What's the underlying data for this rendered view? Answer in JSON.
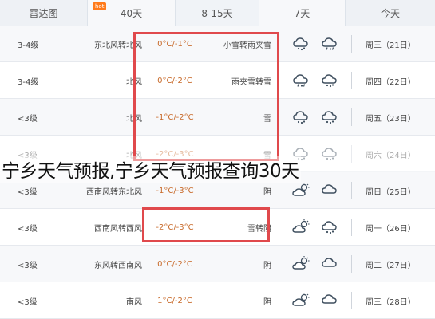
{
  "tabs": [
    {
      "label": "雷达图"
    },
    {
      "label": "40天",
      "badge": "hot"
    },
    {
      "label": "8-15天"
    },
    {
      "label": "7天"
    },
    {
      "label": "今天"
    }
  ],
  "rows": [
    {
      "level": "3-4级",
      "wind": "东北风转北风",
      "temp": "0°C/-1°C",
      "cond": "小雪转雨夹雪",
      "icons": [
        "snow-cloud-icon",
        "sleet-cloud-icon"
      ],
      "date": "周三（21日）"
    },
    {
      "level": "3-4级",
      "wind": "北风",
      "temp": "0°C/-2°C",
      "cond": "雨夹雪转雪",
      "icons": [
        "sleet-cloud-icon",
        "snow-cloud-icon"
      ],
      "date": "周四（22日）"
    },
    {
      "level": "<3级",
      "wind": "北风",
      "temp": "-1°C/-2°C",
      "cond": "雪",
      "icons": [
        "snow-cloud-icon",
        "snow-cloud-icon"
      ],
      "date": "周五（23日）"
    },
    {
      "level": "<3级",
      "wind": "北风",
      "temp": "-2°C/-3°C",
      "cond": "雪",
      "icons": [
        "snow-cloud-icon",
        "snow-cloud-icon"
      ],
      "date": "周六（24日）"
    },
    {
      "level": "<3级",
      "wind": "西南风转东北风",
      "temp": "-1°C/-3°C",
      "cond": "阴",
      "icons": [
        "partly-cloudy-icon",
        "cloud-icon"
      ],
      "date": "周日（25日）"
    },
    {
      "level": "<3级",
      "wind": "西南风转西风",
      "temp": "-2°C/-3°C",
      "cond": "雪转阴",
      "icons": [
        "partly-cloudy-icon",
        "snow-cloud-icon"
      ],
      "date": "周一（26日）"
    },
    {
      "level": "<3级",
      "wind": "东风转西南风",
      "temp": "0°C/-2°C",
      "cond": "阴",
      "icons": [
        "partly-cloudy-icon",
        "cloud-icon"
      ],
      "date": "周二（27日）"
    },
    {
      "level": "<3级",
      "wind": "南风",
      "temp": "1°C/-2°C",
      "cond": "阴",
      "icons": [
        "partly-cloudy-icon",
        "cloud-icon"
      ],
      "date": "周三（28日）"
    }
  ],
  "overlay_title": "宁乡天气预报,宁乡天气预报查询30天",
  "colors": {
    "highlight": "#e0494c",
    "temp_text": "#c86a2a",
    "icon_stroke": "#3f4f5f"
  }
}
